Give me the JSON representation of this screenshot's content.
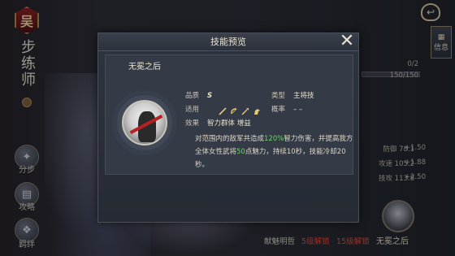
{
  "left_panel": {
    "rank_char": "吴",
    "unit_type": "步练师",
    "buttons": [
      {
        "label": "分步"
      },
      {
        "label": "攻略"
      },
      {
        "label": "羁绊"
      }
    ]
  },
  "top_right": {
    "info_label": "信息",
    "count_a": "0/2",
    "count_b": "150/150"
  },
  "stats": [
    {
      "name": "防御",
      "value": "78.1",
      "bonus": "+1.50"
    },
    {
      "name": "攻速",
      "value": "105.2",
      "bonus": "+1.88"
    },
    {
      "name": "技攻",
      "value": "113.8",
      "bonus": "+2.50"
    }
  ],
  "bottom": {
    "skill_label": "无冕之后",
    "links": [
      {
        "label": "献魅明哲",
        "color": "#d2ccbd"
      },
      {
        "label": "5级解锁",
        "color": "#e0483a"
      },
      {
        "label": "15级解锁",
        "color": "#e0483a"
      }
    ]
  },
  "modal": {
    "title": "技能预览",
    "skill_name": "无冕之后",
    "quality_label": "品质",
    "quality_value": "S",
    "type_label": "类型",
    "type_value": "主将技",
    "fit_label": "适用",
    "prob_label": "概率",
    "prob_value": "– –",
    "effect_label": "效果",
    "effect_value": "智力群体 增益",
    "desc_part1": "对范围内的敌军共造成",
    "desc_pct": "120%",
    "desc_part2": "智力伤害，并提高我方全体女性武将",
    "desc_num": "50",
    "desc_part3": "点魅力，持续10秒，技能冷却20秒。"
  },
  "colors": {
    "highlight_green": "#6fd46a",
    "accent_red": "#e0483a"
  }
}
